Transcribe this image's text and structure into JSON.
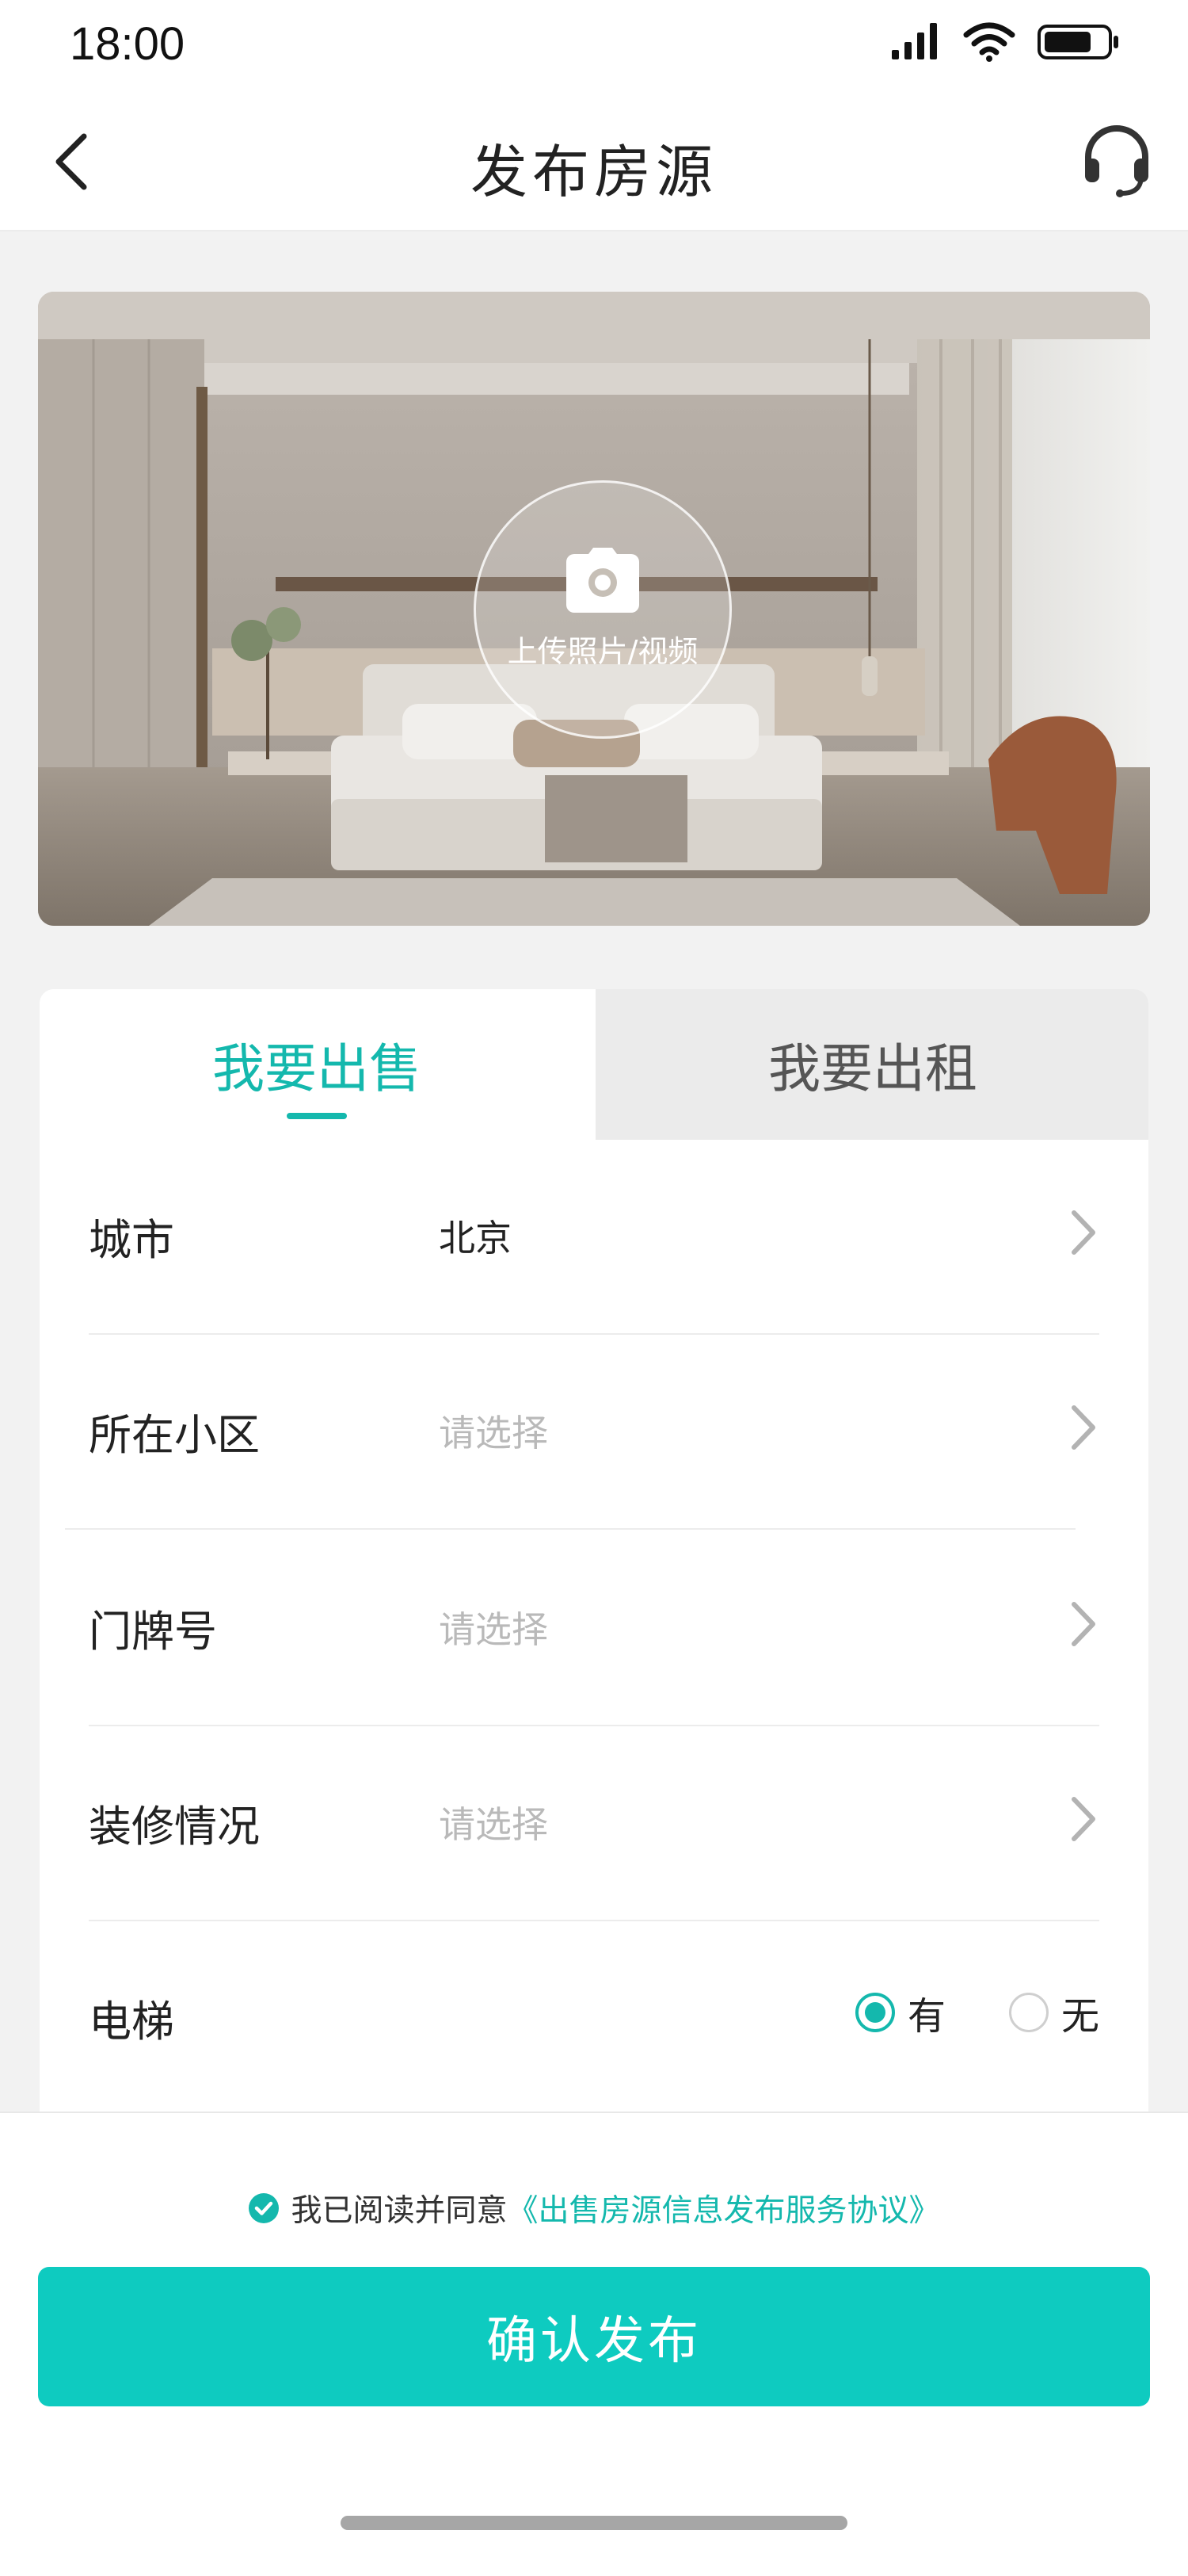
{
  "status_bar": {
    "time": "18:00"
  },
  "nav": {
    "title": "发布房源"
  },
  "hero": {
    "upload_label": "上传照片/视频"
  },
  "tabs": [
    {
      "label": "我要出售",
      "active": true
    },
    {
      "label": "我要出租",
      "active": false
    }
  ],
  "form": {
    "city": {
      "label": "城市",
      "value": "北京"
    },
    "community": {
      "label": "所在小区",
      "placeholder": "请选择"
    },
    "door_number": {
      "label": "门牌号",
      "placeholder": "请选择"
    },
    "decoration": {
      "label": "装修情况",
      "placeholder": "请选择"
    },
    "elevator": {
      "label": "电梯",
      "options": [
        "有",
        "无"
      ],
      "selected": "有"
    }
  },
  "agreement": {
    "text": "我已阅读并同意",
    "link": "《出售房源信息发布服务协议》",
    "checked": true
  },
  "confirm_button": {
    "label": "确认发布"
  },
  "colors": {
    "accent": "#14b8ad",
    "button": "#0ecbc0"
  }
}
